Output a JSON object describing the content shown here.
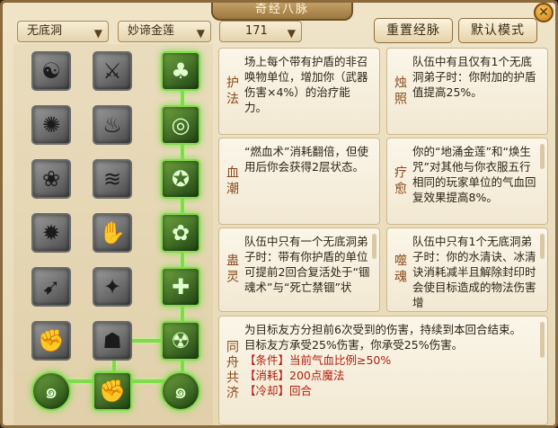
{
  "window": {
    "title": "奇经八脉",
    "close_icon": "close-icon"
  },
  "toolbar": {
    "sect_dropdown": "无底洞",
    "school_dropdown": "妙谛金莲",
    "level_field": "171",
    "reset_button": "重置经脉",
    "default_button": "默认模式"
  },
  "skills": [
    {
      "icon": "meditating-figure-icon",
      "glyph": "☯",
      "active": false
    },
    {
      "icon": "sword-strike-icon",
      "glyph": "⚔",
      "active": false
    },
    {
      "icon": "twin-figures-icon",
      "glyph": "♣",
      "active": true
    },
    {
      "icon": "swirl-wind-icon",
      "glyph": "✺",
      "active": false
    },
    {
      "icon": "tree-stump-icon",
      "glyph": "♨",
      "active": false
    },
    {
      "icon": "life-ring-icon",
      "glyph": "◎",
      "active": true
    },
    {
      "icon": "lotus-icon",
      "glyph": "❀",
      "active": false
    },
    {
      "icon": "cyclone-icon",
      "glyph": "≋",
      "active": false
    },
    {
      "icon": "spiral-shield-icon",
      "glyph": "✪",
      "active": true
    },
    {
      "icon": "fire-ring-icon",
      "glyph": "✹",
      "active": false
    },
    {
      "icon": "claw-hand-icon",
      "glyph": "✋",
      "active": false
    },
    {
      "icon": "flame-cluster-icon",
      "glyph": "✿",
      "active": true
    },
    {
      "icon": "boot-icon",
      "glyph": "➹",
      "active": false
    },
    {
      "icon": "spiked-figure-icon",
      "glyph": "✦",
      "active": false
    },
    {
      "icon": "plus-figure-icon",
      "glyph": "✚",
      "active": true
    },
    {
      "icon": "fist-icon",
      "glyph": "✊",
      "active": false
    },
    {
      "icon": "shadow-figure-icon",
      "glyph": "☗",
      "active": false
    },
    {
      "icon": "demon-face-icon",
      "glyph": "☢",
      "active": true
    },
    {
      "icon": "swirl-cloud-icon",
      "glyph": "๑",
      "active": true
    },
    {
      "icon": "grasping-hand-icon",
      "glyph": "✊",
      "active": true
    },
    {
      "icon": "swirl-orb-icon",
      "glyph": "๑",
      "active": true
    }
  ],
  "cards": [
    {
      "name": "护法",
      "text": "场上每个带有护盾的非召唤物单位，增加你（武器伤害×4%）的治疗能力。"
    },
    {
      "name": "烛照",
      "text": "队伍中有且仅有1个无底洞弟子时：你附加的护盾值提高25%。"
    },
    {
      "name": "血潮",
      "text": "“燃血术”消耗翻倍，但使用后你会获得2层状态。"
    },
    {
      "name": "疗愈",
      "text": "你的“地涌金莲”和“焕生咒”对其他与你衣服五行相同的玩家单位的气血回复效果提高8%。"
    },
    {
      "name": "蛊灵",
      "text": "队伍中只有一个无底洞弟子时：带有你护盾的单位可提前2回合复活处于“锢魂术”与“死亡禁锢”状"
    },
    {
      "name": "噬魂",
      "text": "队伍中只有1个无底洞弟子时：你的水清诀、冰清诀消耗减半且解除封印时会使目标造成的物法伤害增"
    }
  ],
  "detail": {
    "name": "同舟共济",
    "line1": "为目标友方分担前6次受到的伤害，持续到本回合结束。",
    "line2": "目标友方承受25%伤害，你承受25%伤害。",
    "cond": "【条件】当前气血比例≥50%",
    "cost": "【消耗】200点魔法",
    "more": "【冷却】回合"
  }
}
